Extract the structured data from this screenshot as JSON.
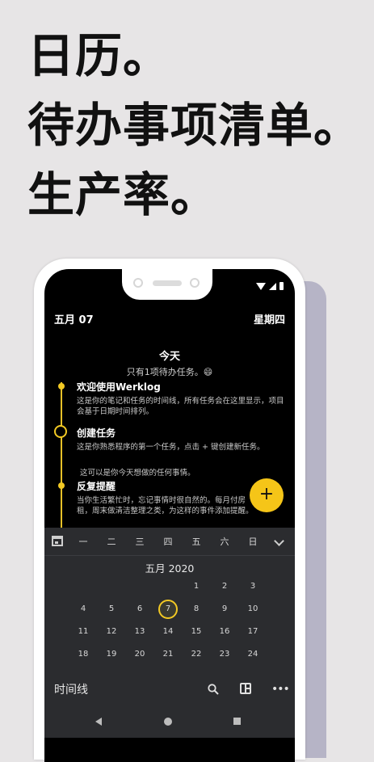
{
  "headline": [
    "日历。",
    "待办事项清单。",
    "生产率。"
  ],
  "header": {
    "date": "五月 07",
    "weekday": "星期四"
  },
  "today": {
    "title": "今天",
    "subtitle": "只有1项待办任务。😄"
  },
  "timeline": [
    {
      "title": "欢迎使用Werklog",
      "desc": "这是你的笔记和任务的时间线，所有任务会在这里显示，项目会基于日期时间排列。"
    },
    {
      "title": "创建任务",
      "desc": "这是你熟悉程序的第一个任务，点击 + 键创建新任务。"
    },
    {
      "title": "反复提醒",
      "desc": "当你生活繁忙时，忘记事情时很自然的。每月付房租，周末做清洁整理之类，为这样的事件添加提醒。"
    }
  ],
  "timeline_note": "这可以是你今天想做的任何事情。",
  "fab": {
    "label": "+"
  },
  "calendar": {
    "weekdays": [
      "一",
      "二",
      "三",
      "四",
      "五",
      "六",
      "日"
    ],
    "month_label": "五月 2020",
    "selected_day": "7",
    "weeks": [
      [
        "",
        "",
        "",
        "",
        "1",
        "2",
        "3"
      ],
      [
        "4",
        "5",
        "6",
        "7",
        "8",
        "9",
        "10"
      ],
      [
        "11",
        "12",
        "13",
        "14",
        "15",
        "16",
        "17"
      ],
      [
        "18",
        "19",
        "20",
        "21",
        "22",
        "23",
        "24"
      ]
    ]
  },
  "bottom_bar": {
    "title": "时间线",
    "more": "•••"
  },
  "icons": [
    "calendar-icon",
    "chevron-down-icon",
    "search-icon",
    "layout-icon",
    "more-icon",
    "back-icon",
    "home-icon",
    "recents-icon"
  ],
  "colors": {
    "accent": "#f2c924",
    "background": "#e7e5e6",
    "panel": "#2b2c2f"
  }
}
